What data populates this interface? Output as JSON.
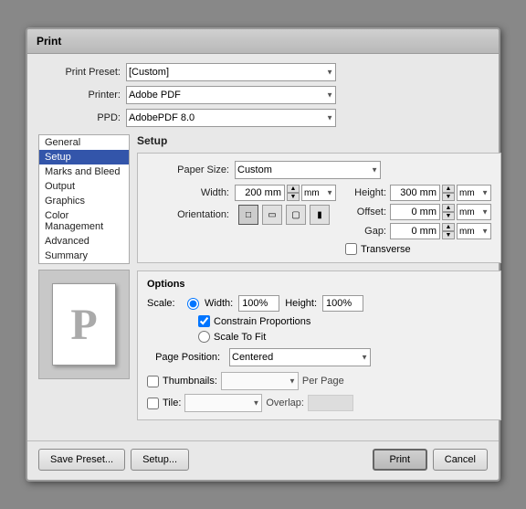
{
  "dialog": {
    "title": "Print",
    "presetLabel": "Print Preset:",
    "presetValue": "[Custom]",
    "printerLabel": "Printer:",
    "printerValue": "Adobe PDF",
    "ppdLabel": "PPD:",
    "ppdValue": "AdobePDF 8.0"
  },
  "nav": {
    "items": [
      "General",
      "Setup",
      "Marks and Bleed",
      "Output",
      "Graphics",
      "Color Management",
      "Advanced",
      "Summary"
    ],
    "selected": "Setup"
  },
  "setup": {
    "sectionTitle": "Setup",
    "paperSizeLabel": "Paper Size:",
    "paperSizeValue": "Custom",
    "widthLabel": "Width:",
    "widthValue": "200 mm",
    "heightLabel": "Height:",
    "heightValue": "300 mm",
    "offsetLabel": "Offset:",
    "offsetValue": "0 mm",
    "gapLabel": "Gap:",
    "gapValue": "0 mm",
    "orientationLabel": "Orientation:",
    "transverseLabel": "Transverse",
    "transverseChecked": false
  },
  "options": {
    "title": "Options",
    "scaleLabel": "Scale:",
    "widthRadioLabel": "Width:",
    "widthScaleValue": "100%",
    "heightScaleLabel": "Height:",
    "heightScaleValue": "100%",
    "constrainLabel": "Constrain Proportions",
    "constrainChecked": true,
    "scaleToFitLabel": "Scale To Fit",
    "pagePositionLabel": "Page Position:",
    "pagePositionValue": "Centered",
    "thumbnailsLabel": "Thumbnails:",
    "thumbnailsChecked": false,
    "perPageLabel": "Per Page",
    "tileLabel": "Tile:",
    "tileChecked": false,
    "overlapLabel": "Overlap:"
  },
  "buttons": {
    "savePreset": "Save Preset...",
    "setup": "Setup...",
    "print": "Print",
    "cancel": "Cancel"
  }
}
